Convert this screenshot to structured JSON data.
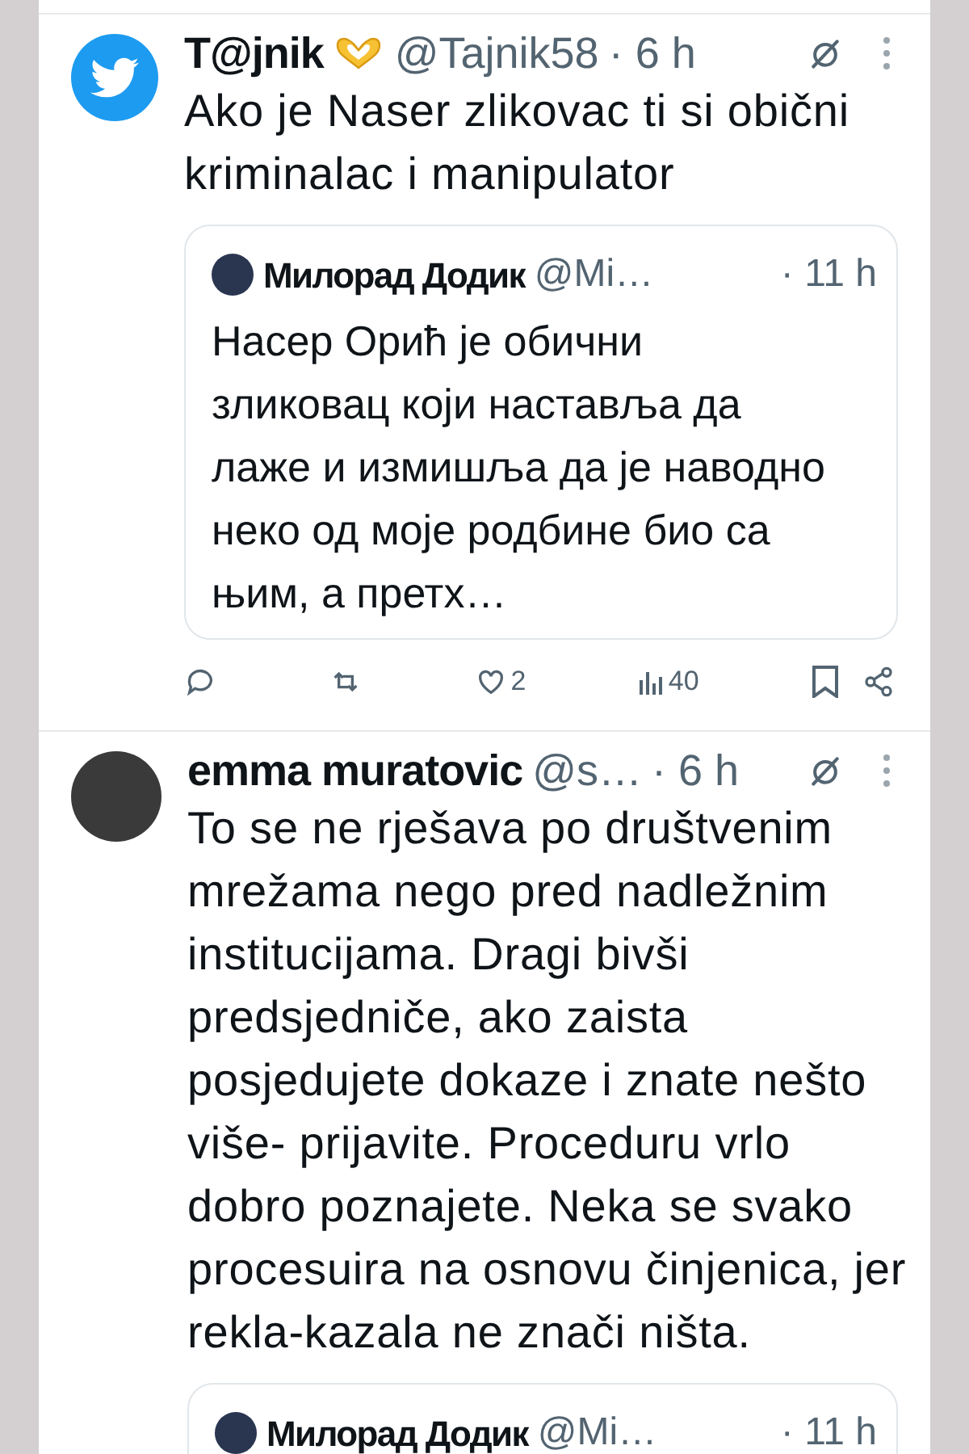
{
  "tweets": [
    {
      "kind": "bird",
      "name": "T@jnik",
      "emoji": true,
      "handle": "@Tajnik58",
      "time": "· 6 h",
      "text": "Ako je Naser zlikovac ti si obični kriminalac i manipulator",
      "quote": {
        "name": "Милорад Додик",
        "handle": "@Mi…",
        "time": "· 11 h",
        "text": "Насер Орић је обични зликовац који наставља да лаже и измишља да је наводно неко од моје родбине био са њим, а претх…"
      },
      "actions": {
        "likes": "2",
        "views": "40"
      }
    },
    {
      "kind": "photo",
      "name": "emma muratovic",
      "emoji": false,
      "handle": "@s…",
      "time": "· 6 h",
      "text": "To se ne rješava po društvenim mrežama nego pred nadležnim institucijama. Dragi bivši predsjedniče, ako zaista posjedujete dokaze i znate nešto više- prijavite. Proceduru vrlo dobro poznajete. Neka se svako procesuira na osnovu činjenica, jer rekla-kazala ne znači ništa.",
      "quote": {
        "name": "Милорад Додик",
        "handle": "@Mi…",
        "time": "· 11 h"
      }
    }
  ]
}
